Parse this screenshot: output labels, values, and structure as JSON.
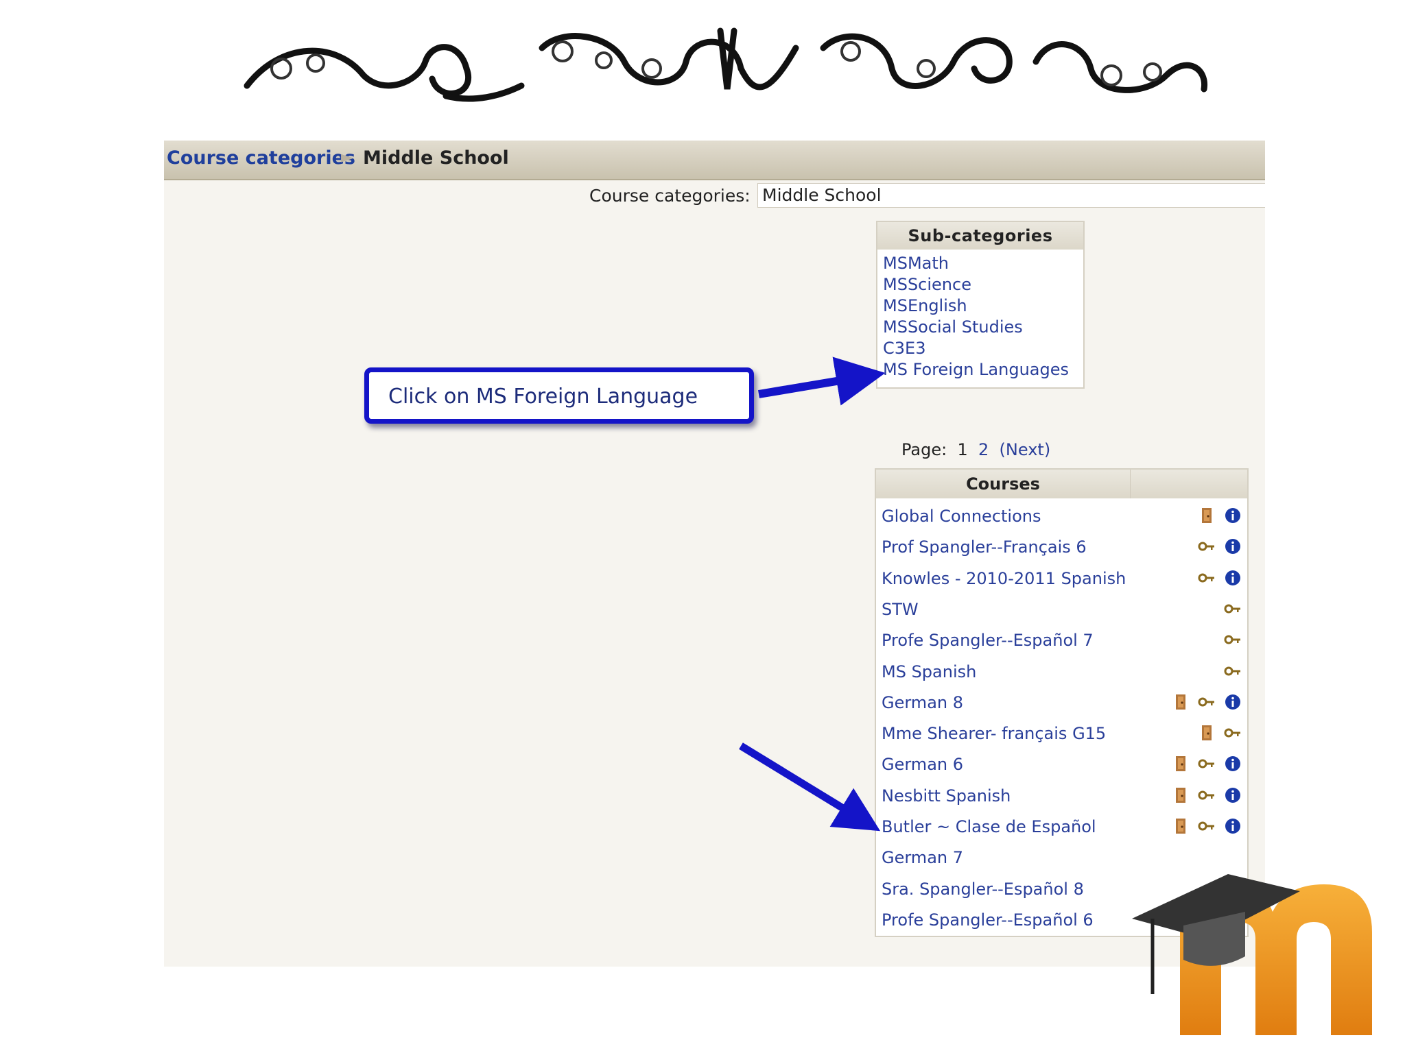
{
  "breadcrumb": {
    "link": "Course categories",
    "separator": "►",
    "current": "Middle School"
  },
  "jump": {
    "label": "Course categories:",
    "value": "Middle School"
  },
  "subcategories": {
    "title": "Sub-categories",
    "items": [
      "MSMath",
      "MSScience",
      "MSEnglish",
      "MSSocial Studies",
      "C3E3",
      "MS Foreign Languages"
    ]
  },
  "callout": {
    "text": "Click on MS Foreign Language"
  },
  "paging": {
    "label": "Page:",
    "current": "1",
    "page2": "2",
    "next": "(Next)"
  },
  "courses": {
    "title": "Courses",
    "rows": [
      {
        "name": "Global Connections",
        "icons": [
          "guest-icon",
          "info-icon"
        ]
      },
      {
        "name": "Prof Spangler--Français 6",
        "icons": [
          "key-icon",
          "info-icon"
        ]
      },
      {
        "name": "Knowles - 2010-2011 Spanish",
        "icons": [
          "key-icon",
          "info-icon"
        ]
      },
      {
        "name": "STW",
        "icons": [
          "key-icon"
        ]
      },
      {
        "name": "Profe Spangler--Español 7",
        "icons": [
          "key-icon"
        ]
      },
      {
        "name": "MS Spanish",
        "icons": [
          "key-icon"
        ]
      },
      {
        "name": "German 8",
        "icons": [
          "guest-icon",
          "key-icon",
          "info-icon"
        ]
      },
      {
        "name": "Mme Shearer- français G15",
        "icons": [
          "guest-icon",
          "key-icon"
        ]
      },
      {
        "name": "German 6",
        "icons": [
          "guest-icon",
          "key-icon",
          "info-icon"
        ]
      },
      {
        "name": "Nesbitt Spanish",
        "icons": [
          "guest-icon",
          "key-icon",
          "info-icon"
        ]
      },
      {
        "name": "Butler ~ Clase de Español",
        "icons": [
          "guest-icon",
          "key-icon",
          "info-icon"
        ]
      },
      {
        "name": "German 7",
        "icons": []
      },
      {
        "name": "Sra. Spangler--Español 8",
        "icons": []
      },
      {
        "name": "Profe Spangler--Español 6",
        "icons": []
      }
    ]
  },
  "colors": {
    "link": "#2a3f9a",
    "callout_border": "#1414c8",
    "arrow": "#1414c8",
    "logo_orange": "#f39a1c"
  },
  "logo": {
    "letter": "m"
  }
}
